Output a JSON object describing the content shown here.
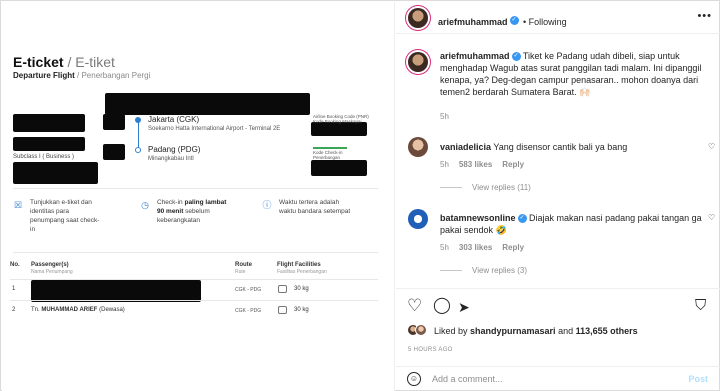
{
  "ticket": {
    "title": "E-ticket",
    "title_sub": "/ E-tiket",
    "flight_label": "Departure Flight",
    "flight_label_sub": "/ Penerbangan Pergi",
    "origin_city": "Jakarta (CGK)",
    "origin_airport": "Soekarno Hatta International Airport - Terminal 2E",
    "dest_city": "Padang (PDG)",
    "dest_airport": "Minangkabau Intl",
    "pnr_label": "Airline Booking Code (PNR)",
    "pnr_label_sub": "Kode Booking Maskapai",
    "checkin_label": "Kode Check-in",
    "checkin_label_sub": "Penerbangan",
    "subclass": "Subclass I ( Business )",
    "info": [
      {
        "icon": "id-card-icon",
        "glyph": "☒",
        "line1": "Tunjukkan e-tiket dan",
        "line2": "identitas para",
        "line3": "penumpang saat check-",
        "line4": "in"
      },
      {
        "icon": "clock-icon",
        "glyph": "◷",
        "line1_pre": "Check-in ",
        "line1_bold": "paling lambat",
        "line2_bold": "90 menit",
        "line2_post": " sebelum",
        "line3": "keberangkatan"
      },
      {
        "icon": "info-icon",
        "glyph": "ⓘ",
        "line1": "Waktu tertera adalah",
        "line2": "waktu bandara setempat"
      }
    ],
    "table": {
      "headers": [
        {
          "label": "No.",
          "sub": ""
        },
        {
          "label": "Passenger(s)",
          "sub": "Nama Penumpang"
        },
        {
          "label": "Route",
          "sub": "Rute"
        },
        {
          "label": "Flight Facilities",
          "sub": "Fasilitas Penerbangan"
        }
      ],
      "rows": [
        {
          "no": "1",
          "name": "",
          "route": "CGK - PDG",
          "baggage": "30 kg"
        },
        {
          "no": "2",
          "name_prefix": "Tn. ",
          "name": "MUHAMMAD ARIEF",
          "name_suffix": " (Dewasa)",
          "route": "CGK - PDG",
          "baggage": "30 kg"
        }
      ]
    }
  },
  "post": {
    "author": "ariefmuhammad",
    "following_label": "Following",
    "caption": "Tiket ke Padang udah dibeli, siap untuk menghadap Wagub atas surat panggilan tadi malam. Ini dipanggil kenapa, ya? Deg-degan campur penasaran.. mohon doanya dari temen2 berdarah Sumatera Barat. 🙌🏻",
    "caption_time": "5h",
    "comments": [
      {
        "user": "vaniadelicia",
        "text": "Yang disensor cantik bali ya bang",
        "time": "5h",
        "likes": "583 likes",
        "reply": "Reply",
        "view_replies": "View replies (11)"
      },
      {
        "user": "batamnewsonline",
        "text": "Diajak makan nasi padang pakai tangan ga pakai sendok 🤣",
        "time": "5h",
        "likes": "303 likes",
        "reply": "Reply",
        "view_replies": "View replies (3)"
      }
    ],
    "liked_by_prefix": "Liked by ",
    "liked_by_user": "shandypurnamasari",
    "liked_by_mid": " and ",
    "liked_by_count": "113,655 others",
    "posted_ago": "5 HOURS AGO",
    "comment_placeholder": "Add a comment...",
    "post_label": "Post"
  },
  "colors": {
    "accent": "#3897f0",
    "route_blue": "#2f7fd1",
    "muted": "#8e8e8e"
  }
}
